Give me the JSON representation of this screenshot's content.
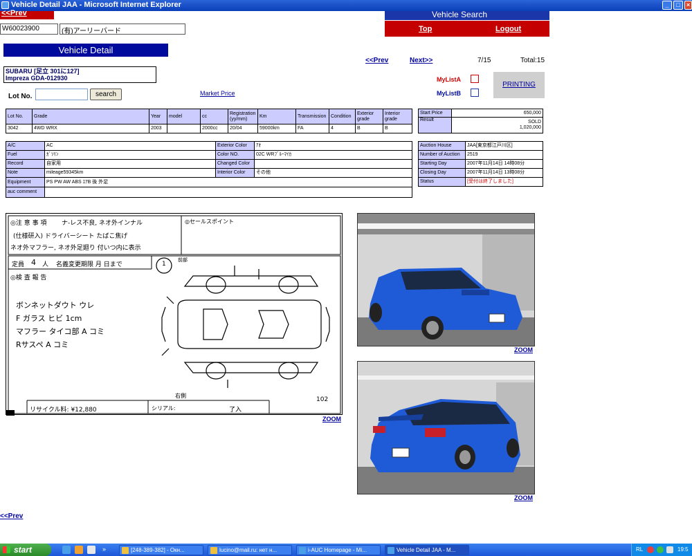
{
  "window": {
    "title": "Vehicle Detail JAA - Microsoft Internet Explorer"
  },
  "header": {
    "prev_label": "<<Prev",
    "vehicle_search": "Vehicle Search",
    "top_label": "Top",
    "logout_label": "Logout",
    "member_id": "W60023900",
    "company": "(有)アーリーバード"
  },
  "page": {
    "title": "Vehicle Detail",
    "prev_label": "<<Prev",
    "next_label": "Next>>",
    "position": "7/15",
    "total": "Total:15",
    "car_title_line1": "SUBARU [足立 301に127]",
    "car_title_line2": "Impreza GDA-012930",
    "lot_label": "Lot No.",
    "search_label": "search",
    "market_price": "Market Price",
    "mylist_a": "MyListA",
    "mylist_b": "MyListB",
    "printing": "PRINTING",
    "zoom": "ZOOM",
    "prev_bottom": "<<Prev"
  },
  "spec_table": {
    "headers": [
      "Lot No.",
      "Grade",
      "Year",
      "model",
      "cc",
      "Registration (yy/mm)",
      "Km",
      "Transmission",
      "Condition",
      "Exterior grade",
      "Interior grade"
    ],
    "values": [
      "3042",
      "4WD WRX",
      "2003",
      "",
      "2000cc",
      "20/04",
      "59000km",
      "FA",
      "4",
      "B",
      "B"
    ]
  },
  "price_table": {
    "start_label": "Start Price",
    "start_value": "650,000",
    "result_label": "Result",
    "result_value": "SOLD",
    "result_price": "1,020,000"
  },
  "features_table": {
    "ac_label": "A/C",
    "ac_value": "AC",
    "ext_color_label": "Exterior Color",
    "ext_color_value": "ｱｵ",
    "fuel_label": "Fuel",
    "fuel_value": "ｶﾞｿﾘﾝ",
    "color_no_label": "Color NO.",
    "color_no_value": "02C WRﾌﾞﾙｰﾏｲｶ",
    "record_label": "Record",
    "record_value": "自家用",
    "changed_color_label": "Changed Color",
    "changed_color_value": "",
    "note_label": "Note",
    "note_value": "mileage59345km",
    "int_color_label": "Interior Color",
    "int_color_value": "その他",
    "equipment_label": "Equipment",
    "equipment_value": "PS PW AW ABS ｴｱB 後 外足",
    "auc_comment_label": "auc comment",
    "auc_comment_value": ""
  },
  "auction_table": {
    "house_label": "Auction House",
    "house_value": "JAA[東京都江戸川区]",
    "number_label": "Number of Auction",
    "number_value": "2519",
    "starting_label": "Starting Day",
    "starting_value": "2007年11月14日 14時08分",
    "closing_label": "Closing Day",
    "closing_value": "2007年11月14日 13時08分",
    "status_label": "Status",
    "status_value": "[受付は終了しました]"
  },
  "inspection_sheet": {
    "notes_header": "◎注 意 事 項",
    "notes_line1": "ナ-レス不良, ネオ外インナル",
    "notes_line2": "(仕様研入)   ドライバーシート たばこ焦げ",
    "notes_line3": "ネオ外マフラー, ネオ外足廻り 付いつ内に表示",
    "sales_point": "◎セールスポイント",
    "capacity": "定員",
    "capacity_value": "4",
    "capacity_unit": "人",
    "expiry": "名義変更期限      月      日まで",
    "circle_mark": "1",
    "report_header": "◎検 査 報 告",
    "report_line1": "ボンネットダウト ウレ",
    "report_line2": "F ガラス ヒビ 1cm",
    "report_line3": "マフラー タイコ部 A コミ",
    "report_line4": "Rサスペ A コミ",
    "front_label": "前部",
    "right_label": "右側",
    "recycle_label": "リサイクル料: ¥12,880",
    "serial_label": "シリアル:",
    "serial_value": "了入",
    "sheet_number": "102"
  },
  "taskbar": {
    "start": "start",
    "items": [
      "[248-389-382] - Окн...",
      "lucino@mail.ru: нет н...",
      "i-AUC Homepage - Mi...",
      "Vehicle Detail JAA - M..."
    ],
    "lang": "RL",
    "time": "19:5"
  },
  "colors": {
    "accent_red": "#c40000",
    "accent_blue": "#000a9c",
    "header_cell": "#ccccff",
    "car_blue": "#1f5bd6"
  }
}
